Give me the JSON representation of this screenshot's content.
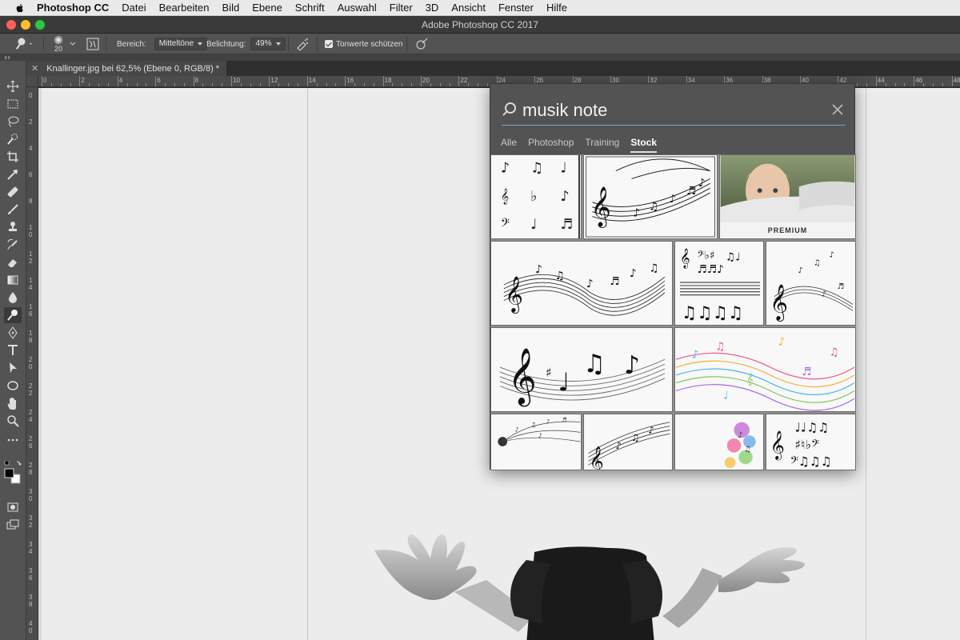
{
  "menubar": {
    "app_name": "Photoshop CC",
    "items": [
      "Datei",
      "Bearbeiten",
      "Bild",
      "Ebene",
      "Schrift",
      "Auswahl",
      "Filter",
      "3D",
      "Ansicht",
      "Fenster",
      "Hilfe"
    ]
  },
  "window": {
    "title": "Adobe Photoshop CC 2017"
  },
  "options_bar": {
    "brush_size": "20",
    "range_label": "Bereich:",
    "range_value": "Mitteltöne",
    "exposure_label": "Belichtung:",
    "exposure_value": "49%",
    "protect_tones_label": "Tonwerte schützen",
    "protect_tones_checked": true
  },
  "document_tab": {
    "title": "Knallinger.jpg bei 62,5% (Ebene 0, RGB/8) *"
  },
  "ruler_top": [
    "0",
    "2",
    "4",
    "6",
    "8",
    "10",
    "12",
    "14",
    "16",
    "18",
    "20",
    "22",
    "24",
    "26",
    "28",
    "30",
    "32",
    "34",
    "36",
    "38",
    "40",
    "42",
    "44",
    "46",
    "48"
  ],
  "ruler_left": [
    "0",
    "2",
    "4",
    "6",
    "8",
    "1 0",
    "1 2",
    "1 4",
    "1 6",
    "1 8",
    "2 0",
    "2 2",
    "2 4",
    "2 6",
    "2 8",
    "3 0",
    "3 2",
    "3 4",
    "3 6",
    "3 8",
    "4 0"
  ],
  "search": {
    "query": "musik note",
    "tabs": [
      "Alle",
      "Photoshop",
      "Training",
      "Stock"
    ],
    "active_tab": "Stock",
    "premium_label": "PREMIUM"
  },
  "colors": {
    "panel": "#535353",
    "canvas": "#ececec",
    "accent_underline": "#7a9fd1"
  },
  "icons": [
    "apple-icon",
    "dodge-tool-icon",
    "brush-preset-icon",
    "airbrush-icon",
    "search-icon",
    "close-icon",
    "move-tool-icon",
    "marquee-tool-icon",
    "lasso-tool-icon",
    "quick-select-icon",
    "crop-tool-icon",
    "eyedropper-icon",
    "healing-brush-icon",
    "brush-tool-icon",
    "clone-stamp-icon",
    "history-brush-icon",
    "eraser-icon",
    "gradient-icon",
    "blur-tool-icon",
    "dodge-tool-icon",
    "pen-tool-icon",
    "type-tool-icon",
    "path-select-icon",
    "ellipse-tool-icon",
    "hand-tool-icon",
    "zoom-tool-icon",
    "more-tools-icon",
    "color-swatches-icon",
    "quick-mask-icon",
    "screen-mode-icon"
  ]
}
